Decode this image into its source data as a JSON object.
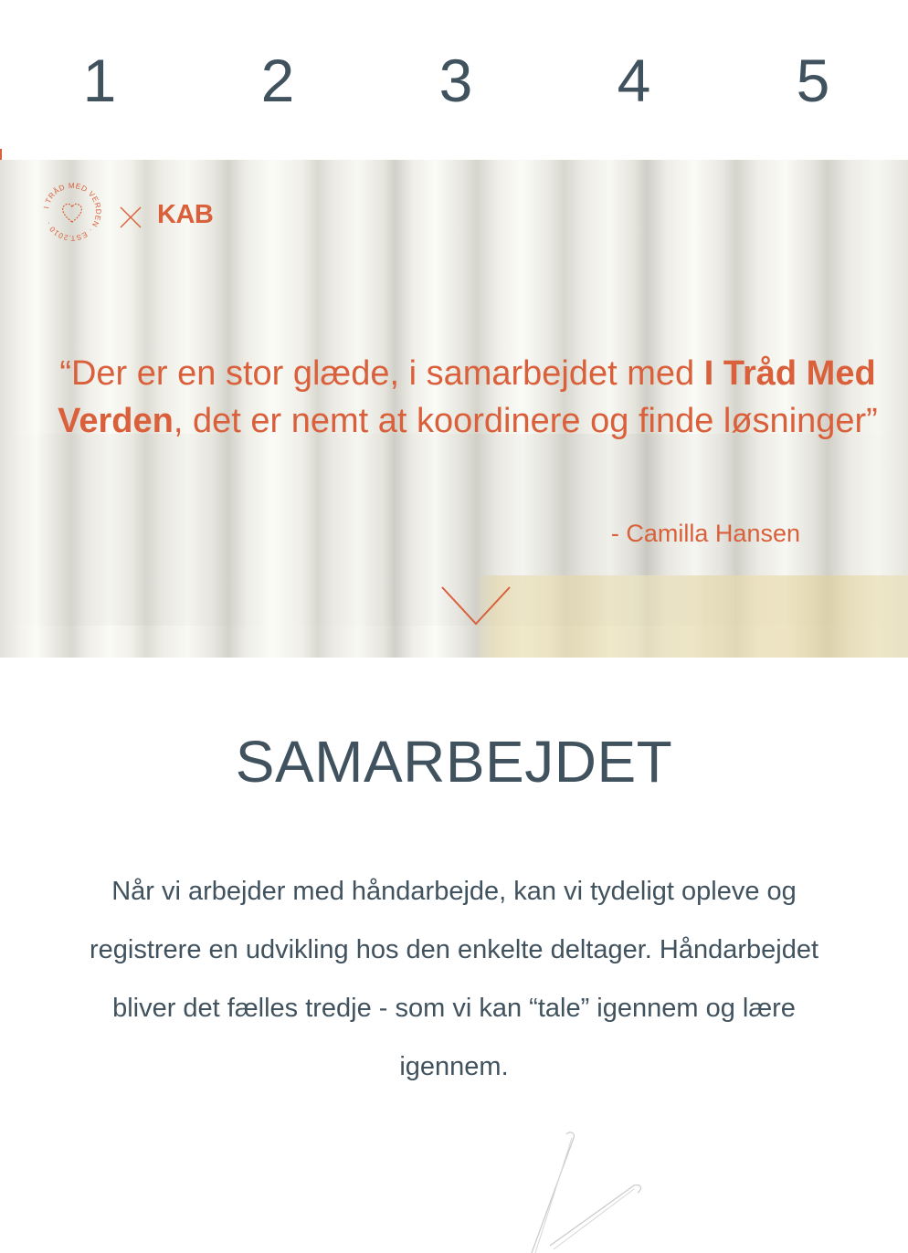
{
  "steps": [
    "1",
    "2",
    "3",
    "4",
    "5"
  ],
  "hero": {
    "logo_badge_text": "I TRÅD MED VERDEN · EST.2010 ·",
    "logo_partner": "KAB",
    "quote_before": "“Der er en stor glæde, i samarbejdet med ",
    "quote_bold": "I Tråd Med Verden",
    "quote_after": ", det er nemt at koordinere og finde løsninger”",
    "quote_author": "- Camilla Hansen"
  },
  "section": {
    "title": "SAMARBEJDET",
    "body": "Når vi arbejder med håndarbejde, kan vi tydeligt opleve og registrere en udvikling hos den enkelte deltager. Håndarbejdet bliver det fælles tredje - som vi kan “tale” igennem og lære igennem."
  },
  "colors": {
    "accent": "#d9603b",
    "text": "#41525f"
  },
  "icons": {
    "logo": "heart-badge-icon",
    "cross": "x-icon",
    "scroll": "chevron-down-icon",
    "decoration": "knitting-needles-icon"
  }
}
